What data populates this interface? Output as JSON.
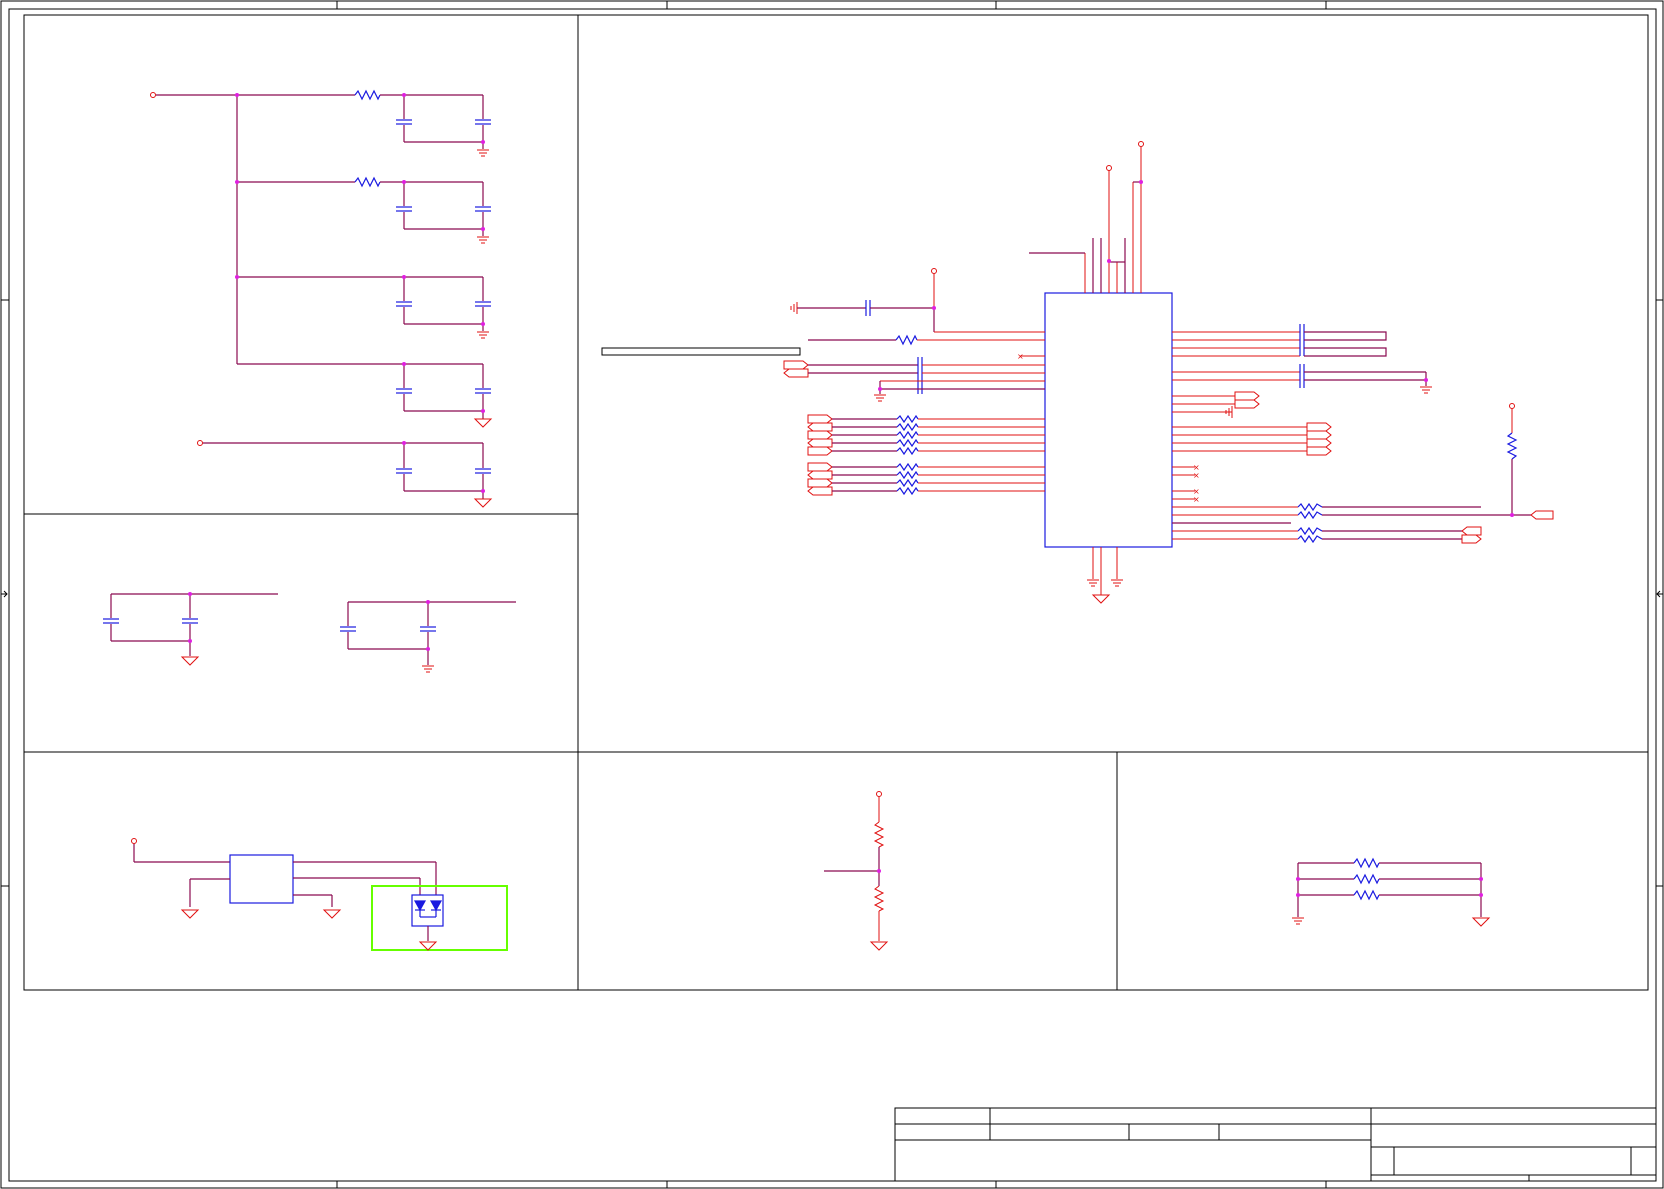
{
  "sheet": {
    "panels": [
      "power-decoupling",
      "clock-decoupling",
      "esd-protection",
      "reset-divider",
      "strap-resistors",
      "main-ic"
    ],
    "title_block": {
      "title": "",
      "size": "",
      "document_number": "",
      "revision": "",
      "date": "",
      "sheet_of": ""
    }
  },
  "colors": {
    "frame": "#000000",
    "wire": "#8b0a50",
    "pin": "#e01010",
    "component": "#1a1ae0",
    "junction": "#e020e0",
    "highlight": "#66ff00"
  },
  "icons": [
    "resistor-icon",
    "capacitor-icon",
    "ground-icon",
    "power-port-icon",
    "off-page-connector-icon",
    "tvs-diode-icon",
    "no-connect-icon"
  ]
}
